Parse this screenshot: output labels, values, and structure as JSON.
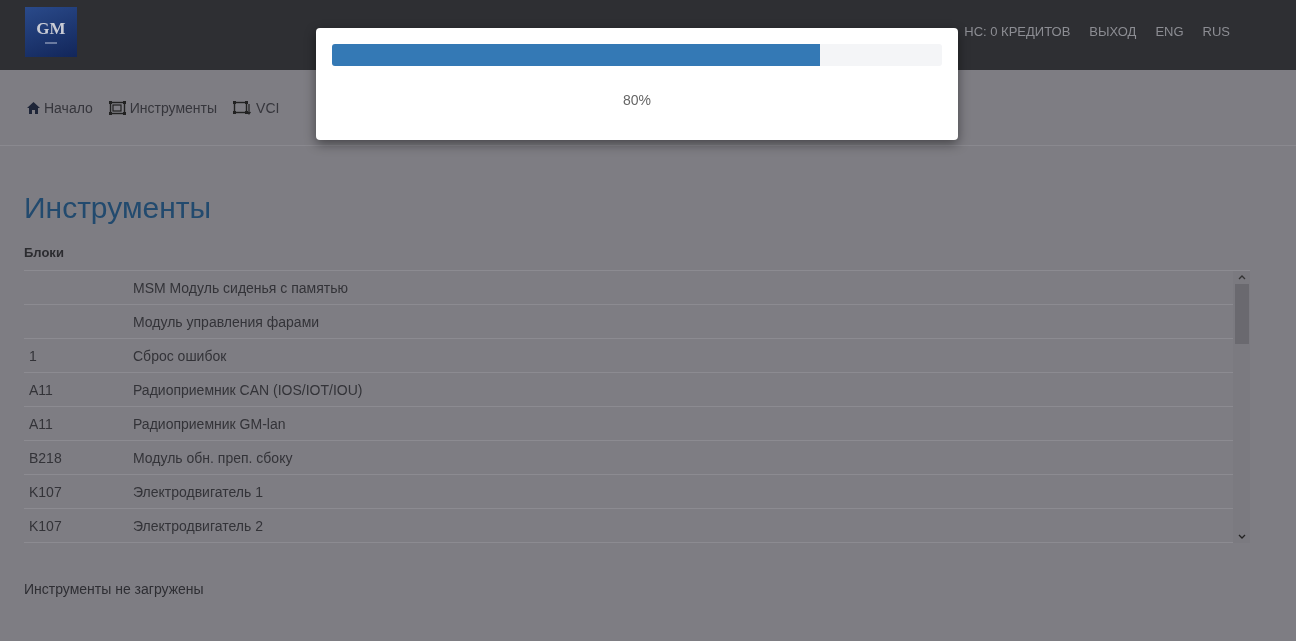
{
  "header": {
    "logo_text": "GM",
    "menu": [
      "НС: 0 КРЕДИТОВ",
      "ВЫХОД",
      "ENG",
      "RUS"
    ]
  },
  "nav": [
    {
      "label": "Начало"
    },
    {
      "label": "Инструменты"
    },
    {
      "label": "VCI"
    }
  ],
  "title": "Инструменты",
  "section": "Блоки",
  "table": {
    "rows": [
      {
        "code": "",
        "name": "MSM Модуль сиденья с памятью"
      },
      {
        "code": "",
        "name": "Модуль управления фарами"
      },
      {
        "code": "1",
        "name": "Сброс ошибок"
      },
      {
        "code": "A11",
        "name": "Радиоприемник CAN (IOS/IOT/IOU)"
      },
      {
        "code": "A11",
        "name": "Радиоприемник GM-lan"
      },
      {
        "code": "B218",
        "name": "Модуль обн. преп. сбоку"
      },
      {
        "code": "K107",
        "name": "Электродвигатель 1"
      },
      {
        "code": "K107",
        "name": "Электродвигатель 2"
      }
    ]
  },
  "status": "Инструменты не загружены",
  "progress_dialog": {
    "level": 0.8,
    "label": "80%"
  }
}
